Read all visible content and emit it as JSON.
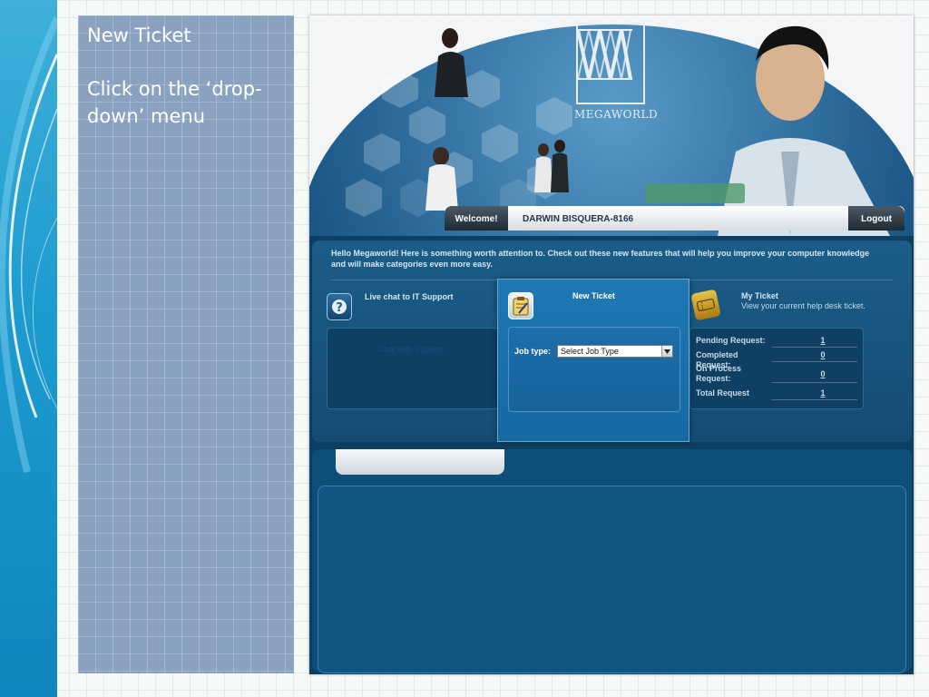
{
  "slide": {
    "title": "New Ticket",
    "instruction": "Click on the ‘drop-down’ menu"
  },
  "app": {
    "logo_text": "MEGAWORLD",
    "welcome_label": "Welcome!",
    "user_name": "DARWIN BISQUERA-8166",
    "logout_label": "Logout",
    "intro_text": "Hello Megaworld! Here is something worth attention to. Check out these new features that will help you improve your computer knowledge and will make categories even more easy.",
    "live_chat": {
      "label": "Live chat to IT Support",
      "link": "Chat with Support"
    },
    "new_ticket": {
      "title": "New Ticket",
      "job_type_label": "Job type:",
      "job_type_selected": "Select Job Type"
    },
    "my_ticket": {
      "title": "My Ticket",
      "subtitle": "View your current help desk ticket.",
      "stats": [
        {
          "label": "Pending Request:",
          "value": "1"
        },
        {
          "label": "Completed Request:",
          "value": "0"
        },
        {
          "label": "On Process Request:",
          "value": "0"
        },
        {
          "label": "Total Request",
          "value": "1"
        }
      ]
    }
  },
  "colors": {
    "instruction_panel": "#8aa1c0",
    "app_background": "#0d3f62",
    "popup": "#1e78b3"
  }
}
